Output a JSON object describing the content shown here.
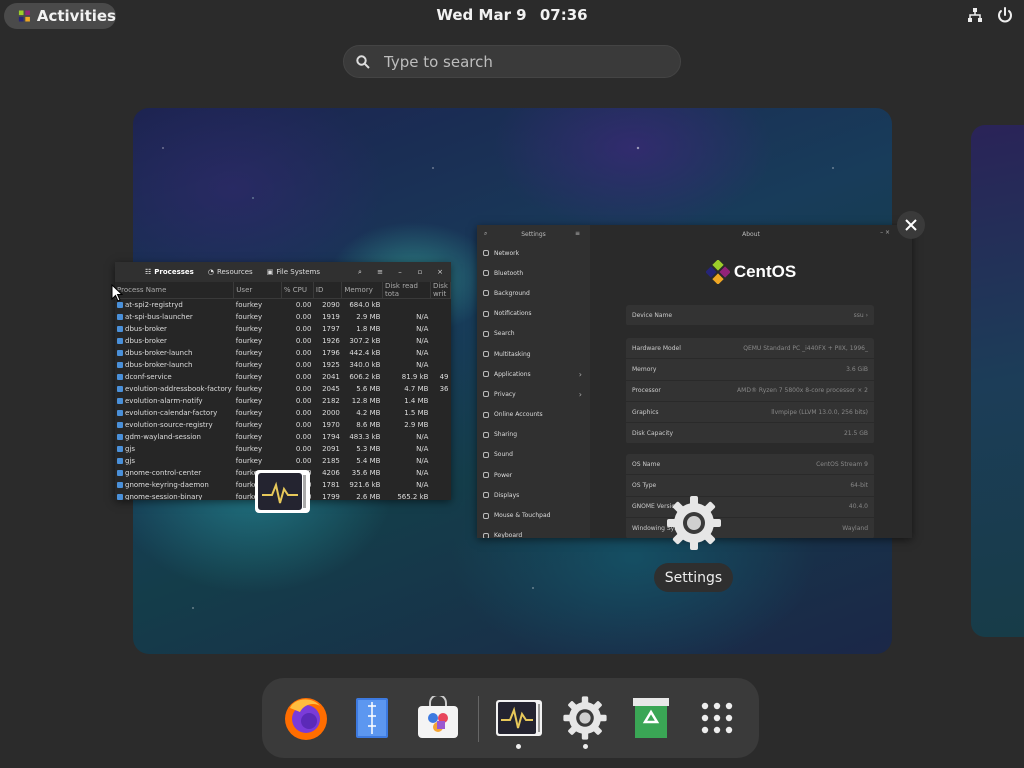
{
  "topbar": {
    "activities_label": "Activities",
    "date": "Wed Mar 9",
    "time": "07:36"
  },
  "search": {
    "placeholder": "Type to search"
  },
  "system_monitor": {
    "tabs": [
      "Processes",
      "Resources",
      "File Systems"
    ],
    "columns": [
      "Process Name",
      "User",
      "% CPU",
      "ID",
      "Memory",
      "Disk read tota",
      "Disk writ"
    ],
    "rows": [
      [
        "at-spi2-registryd",
        "fourkey",
        "0.00",
        "2090",
        "684.0 kB",
        "",
        ""
      ],
      [
        "at-spi-bus-launcher",
        "fourkey",
        "0.00",
        "1919",
        "2.9 MB",
        "N/A",
        ""
      ],
      [
        "dbus-broker",
        "fourkey",
        "0.00",
        "1797",
        "1.8 MB",
        "N/A",
        ""
      ],
      [
        "dbus-broker",
        "fourkey",
        "0.00",
        "1926",
        "307.2 kB",
        "N/A",
        ""
      ],
      [
        "dbus-broker-launch",
        "fourkey",
        "0.00",
        "1796",
        "442.4 kB",
        "N/A",
        ""
      ],
      [
        "dbus-broker-launch",
        "fourkey",
        "0.00",
        "1925",
        "340.0 kB",
        "N/A",
        ""
      ],
      [
        "dconf-service",
        "fourkey",
        "0.00",
        "2041",
        "606.2 kB",
        "81.9 kB",
        "49"
      ],
      [
        "evolution-addressbook-factory",
        "fourkey",
        "0.00",
        "2045",
        "5.6 MB",
        "4.7 MB",
        "36"
      ],
      [
        "evolution-alarm-notify",
        "fourkey",
        "0.00",
        "2182",
        "12.8 MB",
        "1.4 MB",
        ""
      ],
      [
        "evolution-calendar-factory",
        "fourkey",
        "0.00",
        "2000",
        "4.2 MB",
        "1.5 MB",
        ""
      ],
      [
        "evolution-source-registry",
        "fourkey",
        "0.00",
        "1970",
        "8.6 MB",
        "2.9 MB",
        ""
      ],
      [
        "gdm-wayland-session",
        "fourkey",
        "0.00",
        "1794",
        "483.3 kB",
        "N/A",
        ""
      ],
      [
        "gjs",
        "fourkey",
        "0.00",
        "2091",
        "5.3 MB",
        "N/A",
        ""
      ],
      [
        "gjs",
        "fourkey",
        "0.00",
        "2185",
        "5.4 MB",
        "N/A",
        ""
      ],
      [
        "gnome-control-center",
        "fourkey",
        "0.00",
        "4206",
        "35.6 MB",
        "N/A",
        ""
      ],
      [
        "gnome-keyring-daemon",
        "fourkey",
        "0.00",
        "1781",
        "921.6 kB",
        "N/A",
        ""
      ],
      [
        "gnome-session-binary",
        "fourkey",
        "0.00",
        "1799",
        "2.6 MB",
        "565.2 kB",
        ""
      ]
    ]
  },
  "settings_window": {
    "sidebar_title": "Settings",
    "main_title": "About",
    "brand": "CentOS",
    "sidebar_items": [
      "Network",
      "Bluetooth",
      "Background",
      "Notifications",
      "Search",
      "Multitasking",
      "Applications",
      "Privacy",
      "Online Accounts",
      "Sharing",
      "Sound",
      "Power",
      "Displays",
      "Mouse & Touchpad",
      "Keyboard"
    ],
    "device_name_label": "Device Name",
    "device_name_value": "ssu",
    "hardware": [
      [
        "Hardware Model",
        "QEMU Standard PC _i440FX + PIIX, 1996_"
      ],
      [
        "Memory",
        "3.6 GiB"
      ],
      [
        "Processor",
        "AMD® Ryzen 7 5800x 8-core processor × 2"
      ],
      [
        "Graphics",
        "llvmpipe (LLVM 13.0.0, 256 bits)"
      ],
      [
        "Disk Capacity",
        "21.5 GB"
      ]
    ],
    "os": [
      [
        "OS Name",
        "CentOS Stream 9"
      ],
      [
        "OS Type",
        "64-bit"
      ],
      [
        "GNOME Version",
        "40.4.0"
      ],
      [
        "Windowing System",
        "Wayland"
      ]
    ]
  },
  "hover_label": "Settings",
  "colors": {
    "panel": "#2b2b2b",
    "dock": "#3a3a3a",
    "firefox": "#ff6d00",
    "text_editor": "#3d7ae0",
    "trash": "#3aa655"
  }
}
